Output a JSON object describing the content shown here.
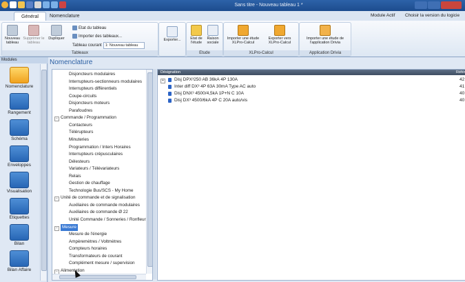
{
  "window": {
    "title": "Sans titre - Nouveau tableau 1 *"
  },
  "ribbon": {
    "tabs": [
      {
        "label": "Général"
      },
      {
        "label": "Nomenclature"
      }
    ],
    "right_info": {
      "module": "Module Actif",
      "choose": "Choisir la version du logicie"
    },
    "groups": {
      "tableaux": {
        "label": "Tableaux",
        "new_label": "Nouveau tableau",
        "delete_label": "Supprimer le tableau",
        "duplicate_label": "Dupliquer",
        "etat_label": "Etat du tableau",
        "import_label": "Importer des tableaux...",
        "current_label": "Tableau courant",
        "current_value": "1: Nouveau tableau"
      },
      "export": {
        "label": "Exporter..."
      },
      "etude": {
        "label": "Etude",
        "state_label": "Etat de l'étude",
        "company_label": "Raison sociale"
      },
      "xlpro": {
        "label": "XLPro-Calcul",
        "import_label": "Importer une étude XLPro-Calcul",
        "export_label": "Exporter vers XLPro-Calcul"
      },
      "drivia": {
        "label": "Application Drivia",
        "import_label": "Importer une étude de l'application Drivia"
      }
    }
  },
  "modules": {
    "header": "Modules",
    "items": [
      {
        "label": "Nomenclature"
      },
      {
        "label": "Rangement"
      },
      {
        "label": "Schéma"
      },
      {
        "label": "Enveloppes"
      },
      {
        "label": "Visualisation"
      },
      {
        "label": "Etiquettes"
      },
      {
        "label": "Bilan"
      },
      {
        "label": "Bilan Affaire"
      }
    ]
  },
  "main": {
    "title": "Nomenclature",
    "tree": [
      {
        "label": "Disjoncteurs modulaires",
        "level": 2
      },
      {
        "label": "Interrupteurs-sectionneurs modulaires",
        "level": 2
      },
      {
        "label": "Interrupteurs différentiels",
        "level": 2
      },
      {
        "label": "Coupe-circuits",
        "level": 2
      },
      {
        "label": "Disjoncteurs moteurs",
        "level": 2
      },
      {
        "label": "Parafoudres",
        "level": 2
      },
      {
        "label": "Commande / Programmation",
        "level": 1
      },
      {
        "label": "Contacteurs",
        "level": 2
      },
      {
        "label": "Télérupteurs",
        "level": 2
      },
      {
        "label": "Minuteries",
        "level": 2
      },
      {
        "label": "Programmation / Inters Horaires",
        "level": 2
      },
      {
        "label": "Interrupteurs crépusculaires",
        "level": 2
      },
      {
        "label": "Délesteurs",
        "level": 2
      },
      {
        "label": "Variateurs / Télévariateurs",
        "level": 2
      },
      {
        "label": "Relais",
        "level": 2
      },
      {
        "label": "Gestion de chauffage",
        "level": 2
      },
      {
        "label": "Technologie Bus/SCS - My Home",
        "level": 2
      },
      {
        "label": "Unité de commande et de signalisation",
        "level": 1
      },
      {
        "label": "Auxiliaires de commande modulaires",
        "level": 2
      },
      {
        "label": "Auxiliaires de commande Ø 22",
        "level": 2
      },
      {
        "label": "Unité Commande / Sonneries / Ronfleurs",
        "level": 2
      },
      {
        "label": "Mesure",
        "level": 1
      },
      {
        "label": "Mesure de l'énergie",
        "level": 2
      },
      {
        "label": "Ampèremètres / Voltmètres",
        "level": 2
      },
      {
        "label": "Compteurs horaires",
        "level": 2
      },
      {
        "label": "Transformateurs de courant",
        "level": 2
      },
      {
        "label": "Complément mesure / supervision",
        "level": 2
      },
      {
        "label": "Alimentation",
        "level": 1
      }
    ],
    "list": {
      "header_designation": "Désignation",
      "header_ref": "Référe",
      "rows": [
        {
          "label": "Disj DPX³250 AB 36kA 4P 130A",
          "ref": "42"
        },
        {
          "label": "Inter diff DX³ 4P 63A 30mA Type AC auto",
          "ref": "41"
        },
        {
          "label": "Disj DNX³ 4500/4,5kA 1P+N C 10A",
          "ref": "40"
        },
        {
          "label": "Disj DX³ 4500/6kA 4P C 20A auto/vis",
          "ref": "40"
        }
      ]
    }
  },
  "colors": {
    "accent": "#2b5fa3",
    "selection": "#3a7ad4",
    "titlebar": "#1c4c8e"
  }
}
